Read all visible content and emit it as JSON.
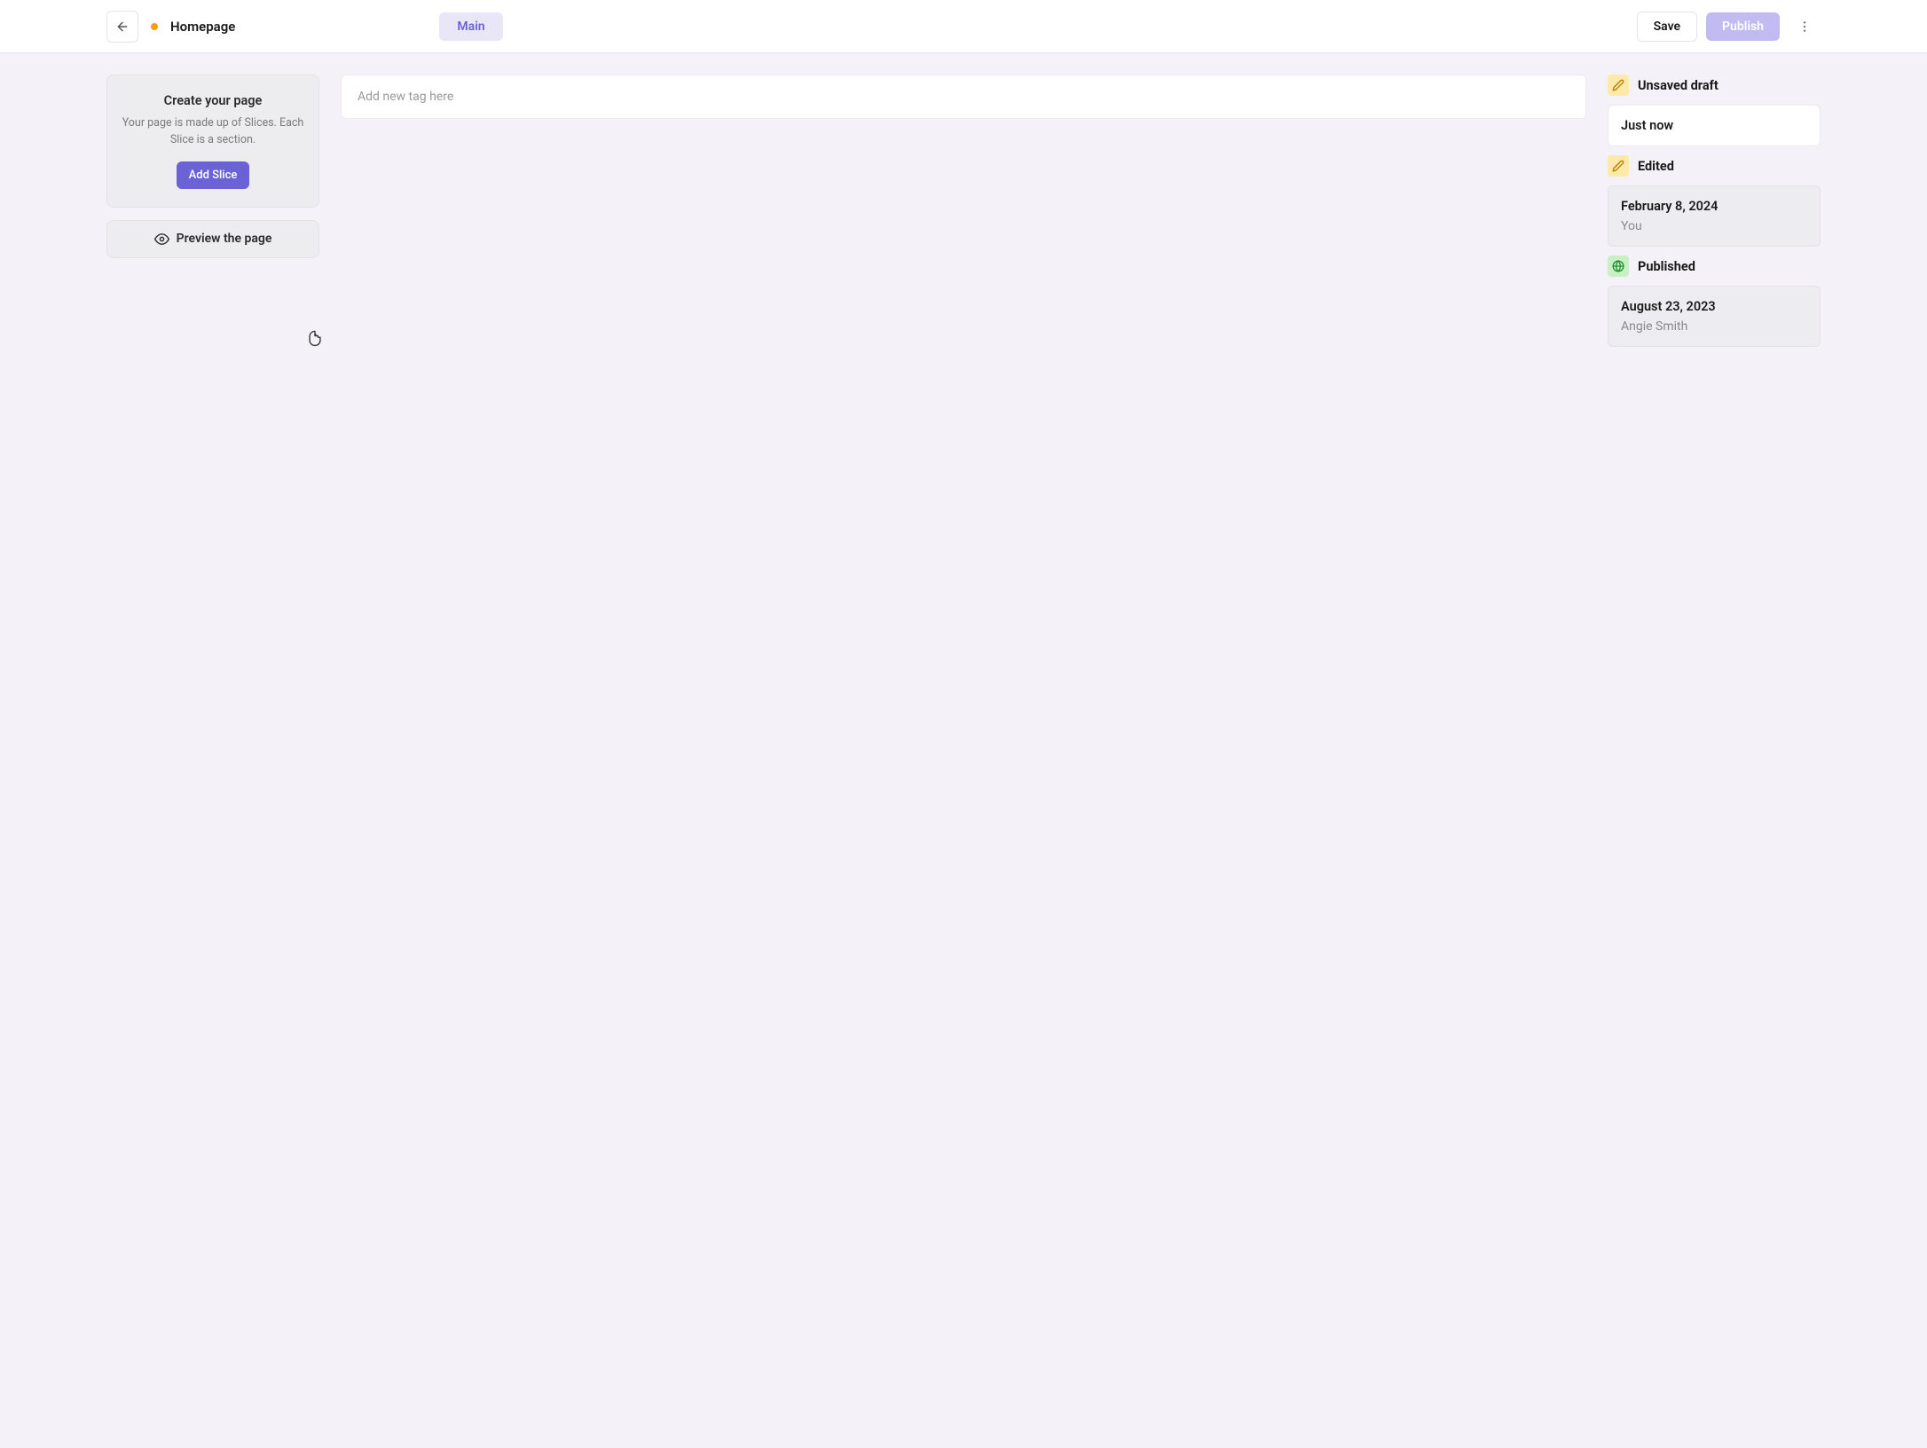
{
  "header": {
    "page_title": "Homepage",
    "tab": "Main",
    "save": "Save",
    "publish": "Publish"
  },
  "left": {
    "create_title": "Create your page",
    "create_desc": "Your page is made up of Slices. Each Slice is a section.",
    "add_slice": "Add Slice",
    "preview": "Preview the page"
  },
  "center": {
    "tag_placeholder": "Add new tag here"
  },
  "right": {
    "draft": {
      "label": "Unsaved draft",
      "time": "Just now"
    },
    "edited": {
      "label": "Edited",
      "date": "February 8, 2024",
      "by": "You"
    },
    "published": {
      "label": "Published",
      "date": "August 23, 2023",
      "by": "Angie Smith"
    }
  }
}
